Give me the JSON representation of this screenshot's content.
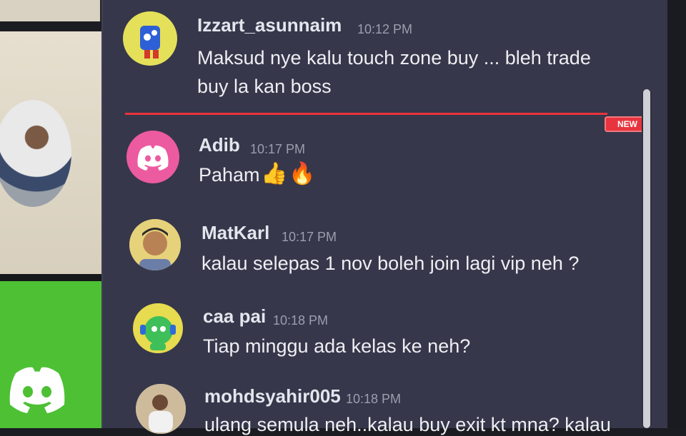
{
  "messages": [
    {
      "author": "Izzart_asunnaim",
      "time": "10:12 PM",
      "lines": [
        "Maksud nye kalu touch zone buy ... bleh trade",
        "buy la kan boss"
      ],
      "avatar_icon": "robot-avatar-icon",
      "avatar_color": "#e4e05a"
    },
    {
      "author": "Adib",
      "time": "10:17 PM",
      "lines": [
        "Paham"
      ],
      "emojis": [
        "👍",
        "🔥"
      ],
      "avatar_icon": "discord-logo-icon",
      "avatar_color": "#ec5aa0"
    },
    {
      "author": "MatKarl",
      "time": "10:17 PM",
      "lines": [
        "kalau selepas 1 nov boleh join lagi vip neh ?"
      ],
      "avatar_icon": "user-photo-avatar",
      "avatar_color": "#c9a36b"
    },
    {
      "author": "caa pai",
      "time": "10:18 PM",
      "lines": [
        "Tiap minggu ada kelas ke neh?"
      ],
      "avatar_icon": "robot-avatar-icon",
      "avatar_color": "#e7db4f"
    },
    {
      "author": "mohdsyahir005",
      "time": "10:18 PM",
      "lines": [
        "ulang semula neh..kalau buy exit kt mna? kalau"
      ],
      "avatar_icon": "user-photo-avatar",
      "avatar_color": "#d9c9b0"
    }
  ],
  "new_divider": {
    "label": "NEW",
    "color": "#e8343e"
  },
  "colors": {
    "chat_bg": "#36374a",
    "accent_green": "#4dc034",
    "text": "#eeeef3",
    "timestamp": "#9c9fae"
  }
}
